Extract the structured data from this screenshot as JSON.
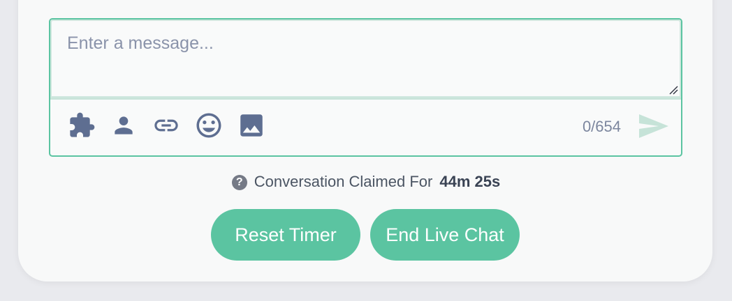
{
  "composer": {
    "placeholder": "Enter a message...",
    "value": "",
    "char_count": "0/654",
    "toolbar": [
      {
        "name": "puzzle-icon"
      },
      {
        "name": "person-icon"
      },
      {
        "name": "link-icon"
      },
      {
        "name": "smiley-icon"
      },
      {
        "name": "image-icon"
      }
    ],
    "send_icon": "send-icon"
  },
  "status": {
    "label": "Conversation Claimed For",
    "duration": "44m 25s",
    "help_glyph": "?"
  },
  "actions": {
    "reset_label": "Reset Timer",
    "end_label": "End Live Chat"
  },
  "colors": {
    "accent": "#5bc4a1",
    "icon": "#5e6e91",
    "send_disabled": "#c6e3d8"
  }
}
